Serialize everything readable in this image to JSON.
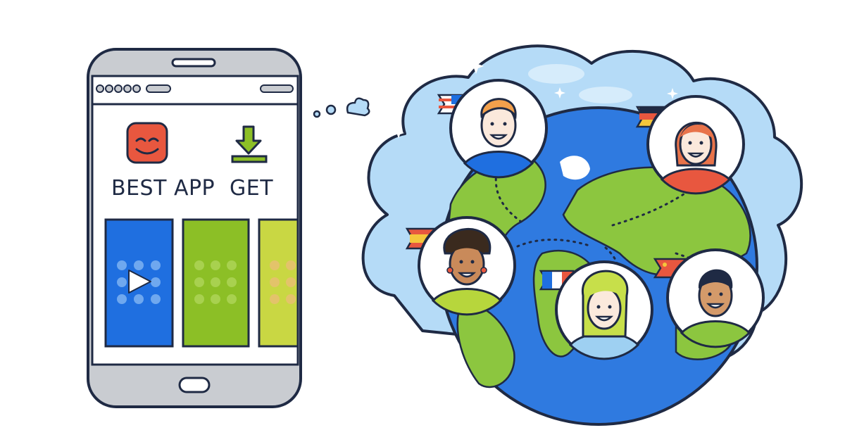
{
  "phone": {
    "app_tile": {
      "label": "BEST APP",
      "icon": "smiley-face-icon",
      "color": "#e8573f"
    },
    "get_tile": {
      "label": "GET",
      "icon": "download-arrow-icon",
      "color": "#8cbf26"
    },
    "cards": [
      {
        "name": "video-card",
        "color": "#1f6fe0",
        "icon": "play-icon"
      },
      {
        "name": "green-card",
        "color": "#8cbf26"
      },
      {
        "name": "lime-card",
        "color": "#c9d743"
      }
    ]
  },
  "globe": {
    "ocean_color": "#2f7ae0",
    "land_color": "#8cc63f",
    "sky_color": "#b5dbf7",
    "people": [
      {
        "name": "person-usa",
        "flag": "usa-flag-icon",
        "shirt": "#1f6fe0"
      },
      {
        "name": "person-germany",
        "flag": "germany-flag-icon",
        "shirt": "#e8573f"
      },
      {
        "name": "person-spain",
        "flag": "spain-flag-icon",
        "shirt": "#b7d63c"
      },
      {
        "name": "person-france",
        "flag": "france-flag-icon",
        "shirt": "#9ed0f2"
      },
      {
        "name": "person-china",
        "flag": "china-flag-icon",
        "shirt": "#8cc63f"
      }
    ]
  }
}
